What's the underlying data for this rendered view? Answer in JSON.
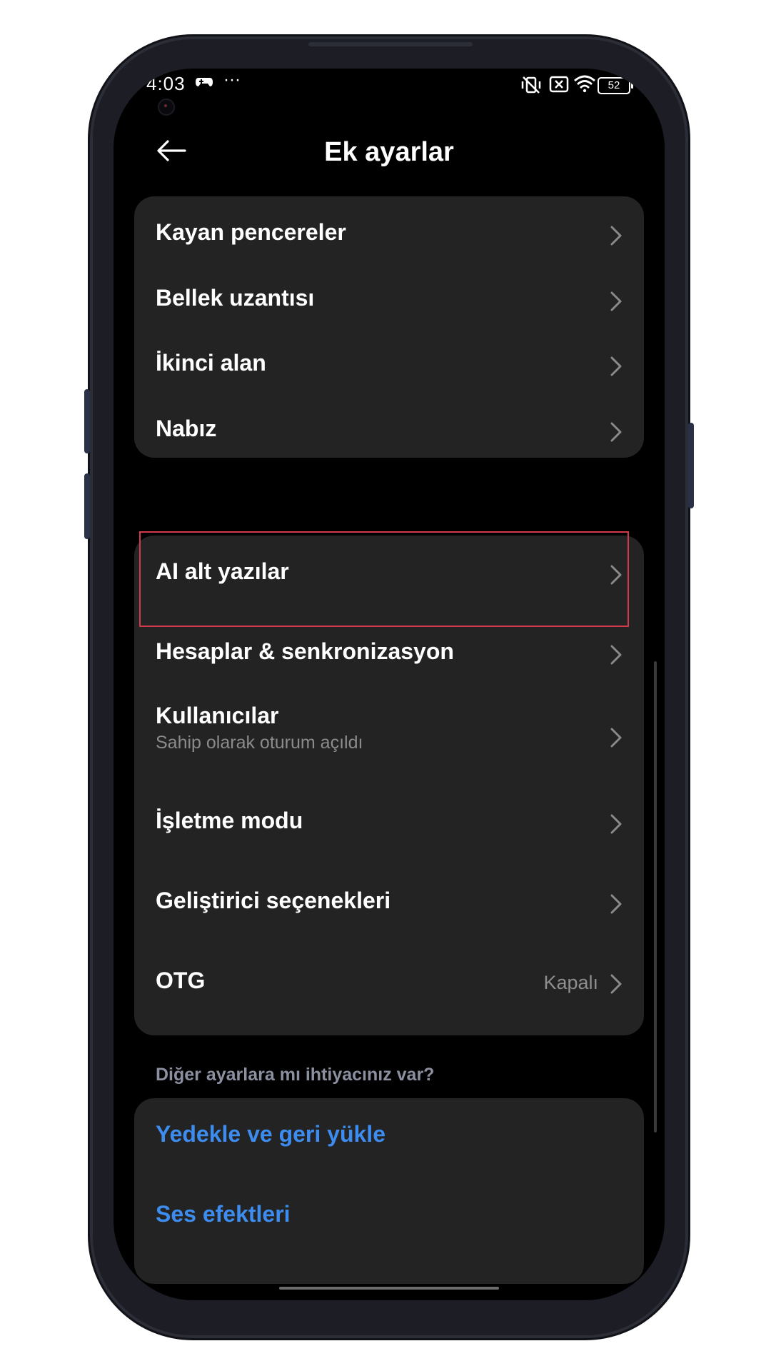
{
  "status_bar": {
    "time": "4:03",
    "battery": "52"
  },
  "header": {
    "title": "Ek ayarlar"
  },
  "group1": {
    "items": [
      {
        "label": "Kayan pencereler"
      },
      {
        "label": "Bellek uzantısı"
      },
      {
        "label": "İkinci alan"
      },
      {
        "label": "Nabız"
      }
    ]
  },
  "group2": {
    "items": [
      {
        "label": "AI alt yazılar"
      },
      {
        "label": "Hesaplar & senkronizasyon"
      },
      {
        "label": "Kullanıcılar",
        "sub": "Sahip olarak oturum açıldı"
      },
      {
        "label": "İşletme modu"
      },
      {
        "label": "Geliştirici seçenekleri"
      },
      {
        "label": "OTG",
        "value": "Kapalı"
      }
    ]
  },
  "more": {
    "hint": "Diğer ayarlara mı ihtiyacınız var?",
    "links": [
      {
        "label": "Yedekle ve geri yükle"
      },
      {
        "label": "Ses efektleri"
      }
    ]
  },
  "colors": {
    "accent": "#3d8df0",
    "highlight": "#d23a4c",
    "card": "#232323"
  }
}
